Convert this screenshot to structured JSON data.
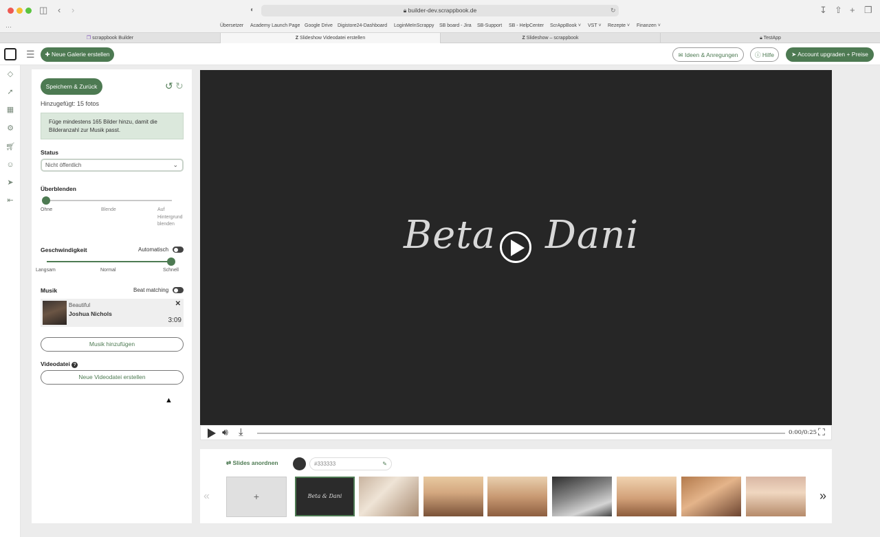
{
  "browser": {
    "url": "builder-dev.scrappbook.de",
    "favorites": [
      "Übersetzer",
      "Academy Launch Page",
      "Google Drive",
      "Digistore24-Dashboard",
      "LoginMeInScrappy",
      "SB board - Jira",
      "SB-Support",
      "SB - HelpCenter",
      "ScrAppBook",
      "VST",
      "Rezepte",
      "Finanzen"
    ],
    "tabs": [
      "scrappbook Builder",
      "Slideshow Videodatei erstellen",
      "Slideshow – scrappbook",
      "TestApp"
    ]
  },
  "header": {
    "new_gallery": "Neue Galerie erstellen",
    "ideas": "Ideen & Anregungen",
    "help": "Hilfe",
    "upgrade": "Account upgraden + Preise"
  },
  "panel": {
    "save_back": "Speichern & Zurück",
    "added": "Hinzugefügt: 15 fotos",
    "alert": "Füge mindestens 165 Bilder hinzu, damit die Bilderanzahl zur Musik passt.",
    "status_label": "Status",
    "status_value": "Nicht öffentlich",
    "crossfade_label": "Überblenden",
    "crossfade_ohne": "Ohne",
    "crossfade_blende": "Blende",
    "crossfade_auf": "Auf",
    "crossfade_hintergrund": "Hintergrund",
    "crossfade_blenden": "blenden",
    "speed_label": "Geschwindigkeit",
    "speed_auto": "Automatisch",
    "speed_slow": "Langsam",
    "speed_normal": "Normal",
    "speed_fast": "Schnell",
    "music_label": "Musik",
    "beat_matching": "Beat matching",
    "track_title": "Beautiful",
    "track_artist": "Joshua Nichols",
    "track_duration": "3:09",
    "add_music": "Musik hinzufügen",
    "video_file_label": "Videodatei",
    "new_video_file": "Neue Videodatei erstellen"
  },
  "player": {
    "title_left": "Beta",
    "title_right": "Dani",
    "time": "0:00/0:25"
  },
  "slides": {
    "arrange": "Slides anordnen",
    "color_value": "#333333",
    "add_symbol": "+",
    "title_thumb": "Beta & Dani"
  }
}
